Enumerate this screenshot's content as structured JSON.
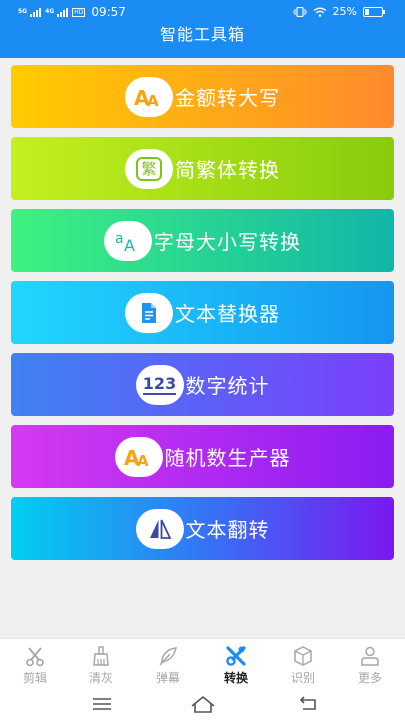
{
  "status_bar": {
    "network_1": "5G",
    "network_2": "4G",
    "hd": "HD",
    "time": "09:57",
    "battery_level": "25%",
    "battery_fraction": 0.25
  },
  "header": {
    "title": "智能工具箱",
    "color": "#1c8cf5"
  },
  "tools": [
    {
      "label": "金额转大写",
      "icon": "aa-icon"
    },
    {
      "label": "简繁体转换",
      "icon": "fan-character-icon",
      "icon_text": "繁"
    },
    {
      "label": "字母大小写转换",
      "icon": "letter-case-icon"
    },
    {
      "label": "文本替换器",
      "icon": "document-icon"
    },
    {
      "label": "数字统计",
      "icon": "number-icon",
      "icon_text": "123"
    },
    {
      "label": "随机数生产器",
      "icon": "aa-icon"
    },
    {
      "label": "文本翻转",
      "icon": "flip-icon"
    }
  ],
  "tabs": [
    {
      "label": "剪辑",
      "icon": "scissors-icon"
    },
    {
      "label": "清灰",
      "icon": "brush-icon"
    },
    {
      "label": "弹幕",
      "icon": "feather-icon"
    },
    {
      "label": "转换",
      "icon": "tools-icon",
      "active": true
    },
    {
      "label": "识别",
      "icon": "box-icon"
    },
    {
      "label": "更多",
      "icon": "person-icon"
    }
  ]
}
